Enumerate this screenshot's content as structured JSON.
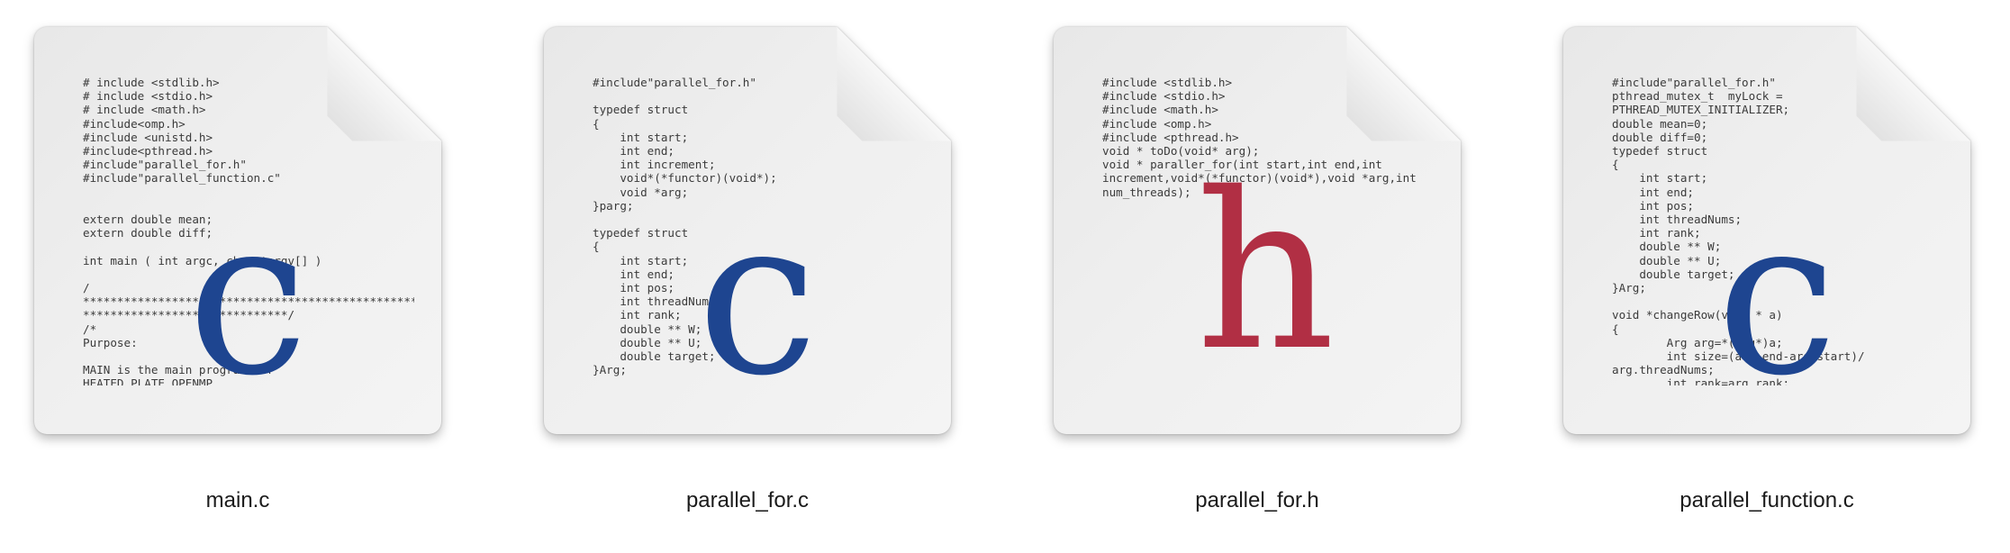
{
  "files": [
    {
      "name": "main.c",
      "letter": "c",
      "code": "# include <stdlib.h>\n# include <stdio.h>\n# include <math.h>\n#include<omp.h>\n#include <unistd.h>\n#include<pthread.h>\n#include\"parallel_for.h\"\n#include\"parallel_function.c\"\n\n\nextern double mean;\nextern double diff;\n\nint main ( int argc, char *argv[] )\n\n/\n*******************************************************\n******************************/\n/*\nPurpose:\n\nMAIN is the main program for\nHEATED_PLATE_OPENMP."
    },
    {
      "name": "parallel_for.c",
      "letter": "c",
      "code": "#include\"parallel_for.h\"\n\ntypedef struct\n{\n    int start;\n    int end;\n    int increment;\n    void*(*functor)(void*);\n    void *arg;\n}parg;\n\ntypedef struct\n{\n    int start;\n    int end;\n    int pos;\n    int threadNums;\n    int rank;\n    double ** W;\n    double ** U;\n    double target;\n}Arg;"
    },
    {
      "name": "parallel_for.h",
      "letter": "h",
      "code": "#include <stdlib.h>\n#include <stdio.h>\n#include <math.h>\n#include <omp.h>\n#include <pthread.h>\nvoid * toDo(void* arg);\nvoid * paraller_for(int start,int end,int\nincrement,void*(*functor)(void*),void *arg,int\nnum_threads);"
    },
    {
      "name": "parallel_function.c",
      "letter": "c",
      "code": "#include\"parallel_for.h\"\npthread_mutex_t  myLock =\nPTHREAD_MUTEX_INITIALIZER;\ndouble mean=0;\ndouble diff=0;\ntypedef struct\n{\n    int start;\n    int end;\n    int pos;\n    int threadNums;\n    int rank;\n    double ** W;\n    double ** U;\n    double target;\n}Arg;\n\nvoid *changeRow(void * a)\n{\n        Arg arg=*(Arg*)a;\n        int size=(arg.end-arg.start)/\narg.threadNums;\n        int rank=arg.rank;"
    }
  ]
}
